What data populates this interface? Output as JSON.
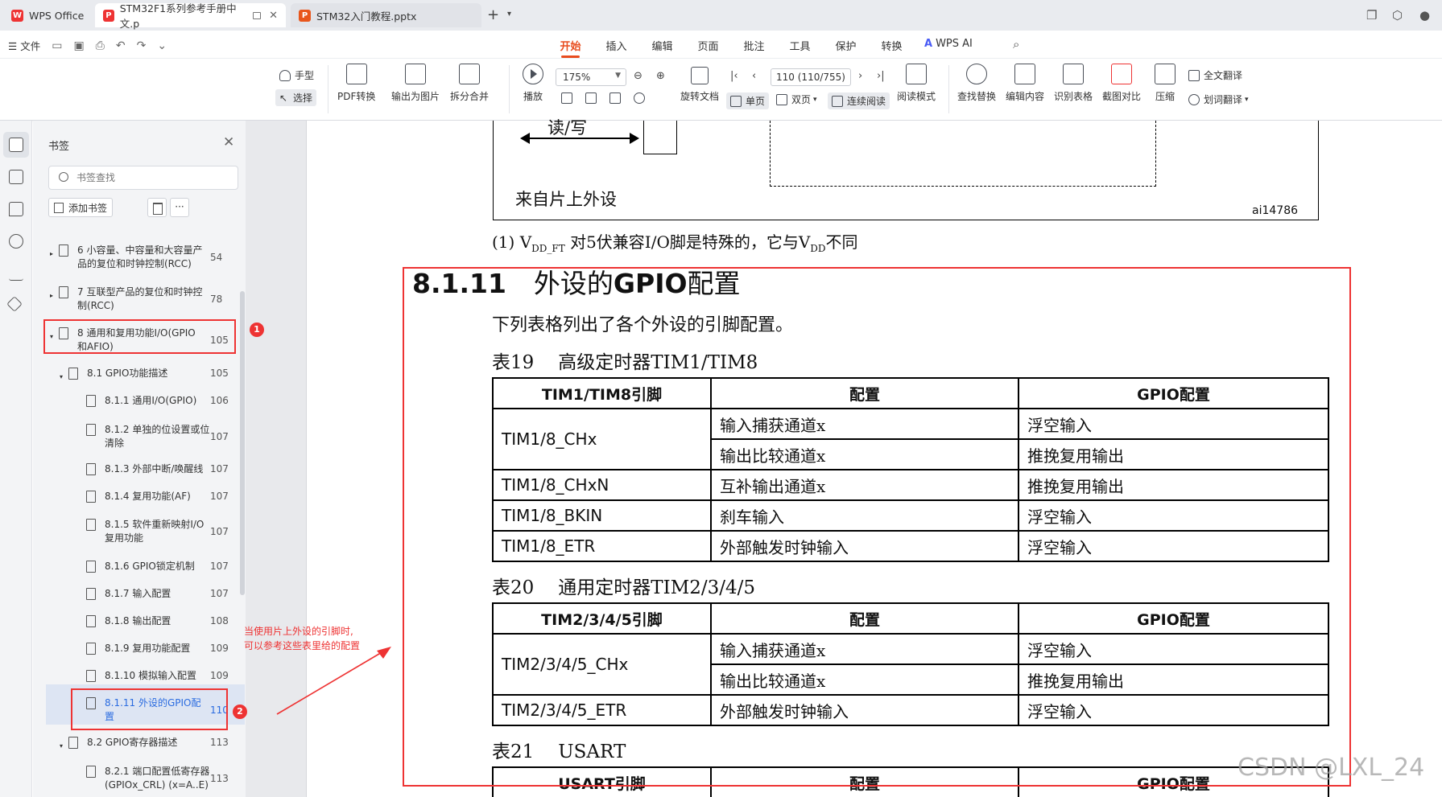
{
  "tabs": {
    "app": "WPS Office",
    "doc1": "STM32F1系列参考手册中文.p",
    "doc2": "STM32入门教程.pptx"
  },
  "menu": {
    "file": "文件",
    "tabs": [
      "开始",
      "插入",
      "编辑",
      "页面",
      "批注",
      "工具",
      "保护",
      "转换"
    ],
    "ai": "WPS AI"
  },
  "ribbon": {
    "hand": "手型",
    "select": "选择",
    "pdf_convert": "PDF转换",
    "export_image": "输出为图片",
    "split_merge": "拆分合并",
    "play": "播放",
    "zoom": "175%",
    "rotate": "旋转文档",
    "single": "单页",
    "double": "双页",
    "continuous": "连续阅读",
    "page": "110 (110/755)",
    "read_mode": "阅读模式",
    "find_replace": "查找替换",
    "edit_content": "编辑内容",
    "recognize_table": "识别表格",
    "screenshot_compare": "截图对比",
    "compress": "压缩",
    "full_translate": "全文翻译",
    "word_translate": "划词翻译"
  },
  "panel": {
    "title": "书签",
    "search_placeholder": "书签查找",
    "add": "添加书签",
    "more": "···",
    "items": [
      {
        "label1": "6 小容量、中容量和大容量产",
        "label2": "品的复位和时钟控制(RCC)",
        "page": "54"
      },
      {
        "label1": "7 互联型产品的复位和时钟控",
        "label2": "制(RCC)",
        "page": "78"
      },
      {
        "label1": "8 通用和复用功能I/O(GPIO",
        "label2": "和AFIO)",
        "page": "105"
      },
      {
        "label1": "8.1 GPIO功能描述",
        "label2": "",
        "page": "105"
      },
      {
        "label1": "8.1.1 通用I/O(GPIO)",
        "label2": "",
        "page": "106"
      },
      {
        "label1": "8.1.2 单独的位设置或位",
        "label2": "清除",
        "page": "107"
      },
      {
        "label1": "8.1.3 外部中断/唤醒线",
        "label2": "",
        "page": "107"
      },
      {
        "label1": "8.1.4 复用功能(AF)",
        "label2": "",
        "page": "107"
      },
      {
        "label1": "8.1.5 软件重新映射I/O",
        "label2": "复用功能",
        "page": "107"
      },
      {
        "label1": "8.1.6 GPIO锁定机制",
        "label2": "",
        "page": "107"
      },
      {
        "label1": "8.1.7 输入配置",
        "label2": "",
        "page": "107"
      },
      {
        "label1": "8.1.8 输出配置",
        "label2": "",
        "page": "108"
      },
      {
        "label1": "8.1.9 复用功能配置",
        "label2": "",
        "page": "109"
      },
      {
        "label1": "8.1.10 模拟输入配置",
        "label2": "",
        "page": "109"
      },
      {
        "label1": "8.1.11 外设的GPIO配",
        "label2": "置",
        "page": "110"
      },
      {
        "label1": "8.2 GPIO寄存器描述",
        "label2": "",
        "page": "113"
      },
      {
        "label1": "8.2.1 端口配置低寄存器",
        "label2": "(GPIOx_CRL) (x=A..E)",
        "page": "113"
      }
    ]
  },
  "annotation": {
    "badge1": "1",
    "badge2": "2",
    "line1": "当使用片上外设的引脚时,",
    "line2": "可以参考这些表里给的配置"
  },
  "doc": {
    "fig_rw": "读/写",
    "fig_from": "来自片上外设",
    "fig_id": "ai14786",
    "note_pre": "(1) V",
    "note_sub1": "DD_FT",
    "note_mid": " 对5伏兼容I/O脚是特殊的，它与V",
    "note_sub2": "DD",
    "note_post": "不同",
    "sec_num": "8.1.11",
    "sec_name_pre": "外设的",
    "sec_name_bold": "GPIO",
    "sec_name_post": "配置",
    "para": "下列表格列出了各个外设的引脚配置。",
    "t19_num": "表19",
    "t19_name": "高级定时器TIM1/TIM8",
    "t19_head": [
      "TIM1/TIM8引脚",
      "配置",
      "GPIO配置"
    ],
    "t19_rows": [
      [
        "TIM1/8_CHx",
        "输入捕获通道x",
        "浮空输入"
      ],
      [
        "",
        "输出比较通道x",
        "推挽复用输出"
      ],
      [
        "TIM1/8_CHxN",
        "互补输出通道x",
        "推挽复用输出"
      ],
      [
        "TIM1/8_BKIN",
        "刹车输入",
        "浮空输入"
      ],
      [
        "TIM1/8_ETR",
        "外部触发时钟输入",
        "浮空输入"
      ]
    ],
    "t20_num": "表20",
    "t20_name": "通用定时器TIM2/3/4/5",
    "t20_head": [
      "TIM2/3/4/5引脚",
      "配置",
      "GPIO配置"
    ],
    "t20_rows": [
      [
        "TIM2/3/4/5_CHx",
        "输入捕获通道x",
        "浮空输入"
      ],
      [
        "",
        "输出比较通道x",
        "推挽复用输出"
      ],
      [
        "TIM2/3/4/5_ETR",
        "外部触发时钟输入",
        "浮空输入"
      ]
    ],
    "t21_num": "表21",
    "t21_name": "USART",
    "t21_head": [
      "USART引脚",
      "配置",
      "GPIO配置"
    ]
  },
  "watermark": "CSDN @LXL_24"
}
